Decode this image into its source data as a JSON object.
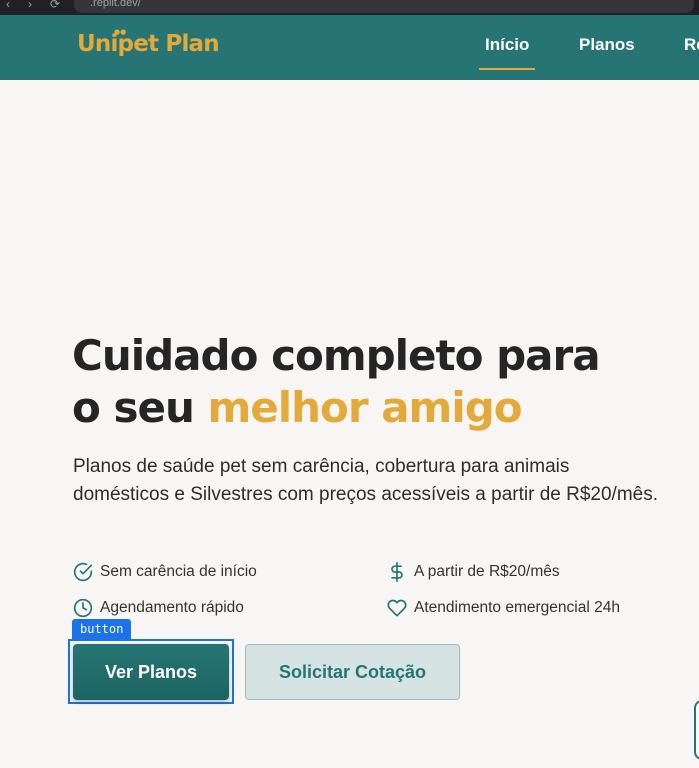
{
  "browser": {
    "url": ".replit.dev/"
  },
  "header": {
    "logo": "Unipet Plan",
    "nav": [
      {
        "label": "Início",
        "active": true
      },
      {
        "label": "Planos",
        "active": false
      },
      {
        "label": "Re",
        "active": false
      }
    ]
  },
  "hero": {
    "title_line1": "Cuidado completo para",
    "title_line2_start": "o seu ",
    "title_line2_accent": "melhor amigo",
    "description": "Planos de saúde pet sem carência, cobertura para animais domésticos e Silvestres com preços acessíveis a partir de R$20/mês."
  },
  "features": [
    {
      "icon": "check-circle-icon",
      "label": "Sem carência de início"
    },
    {
      "icon": "dollar-icon",
      "label": "A partir de R$20/mês"
    },
    {
      "icon": "clock-icon",
      "label": "Agendamento rápido"
    },
    {
      "icon": "heart-icon",
      "label": "Atendimento emergencial 24h"
    }
  ],
  "buttons": {
    "primary": "Ver Planos",
    "secondary": "Solicitar Cotação",
    "annotation_tag": "button"
  },
  "colors": {
    "brand_teal": "#267574",
    "brand_gold": "#e3a93a",
    "background": "#f8f6f4",
    "text": "#252525"
  }
}
